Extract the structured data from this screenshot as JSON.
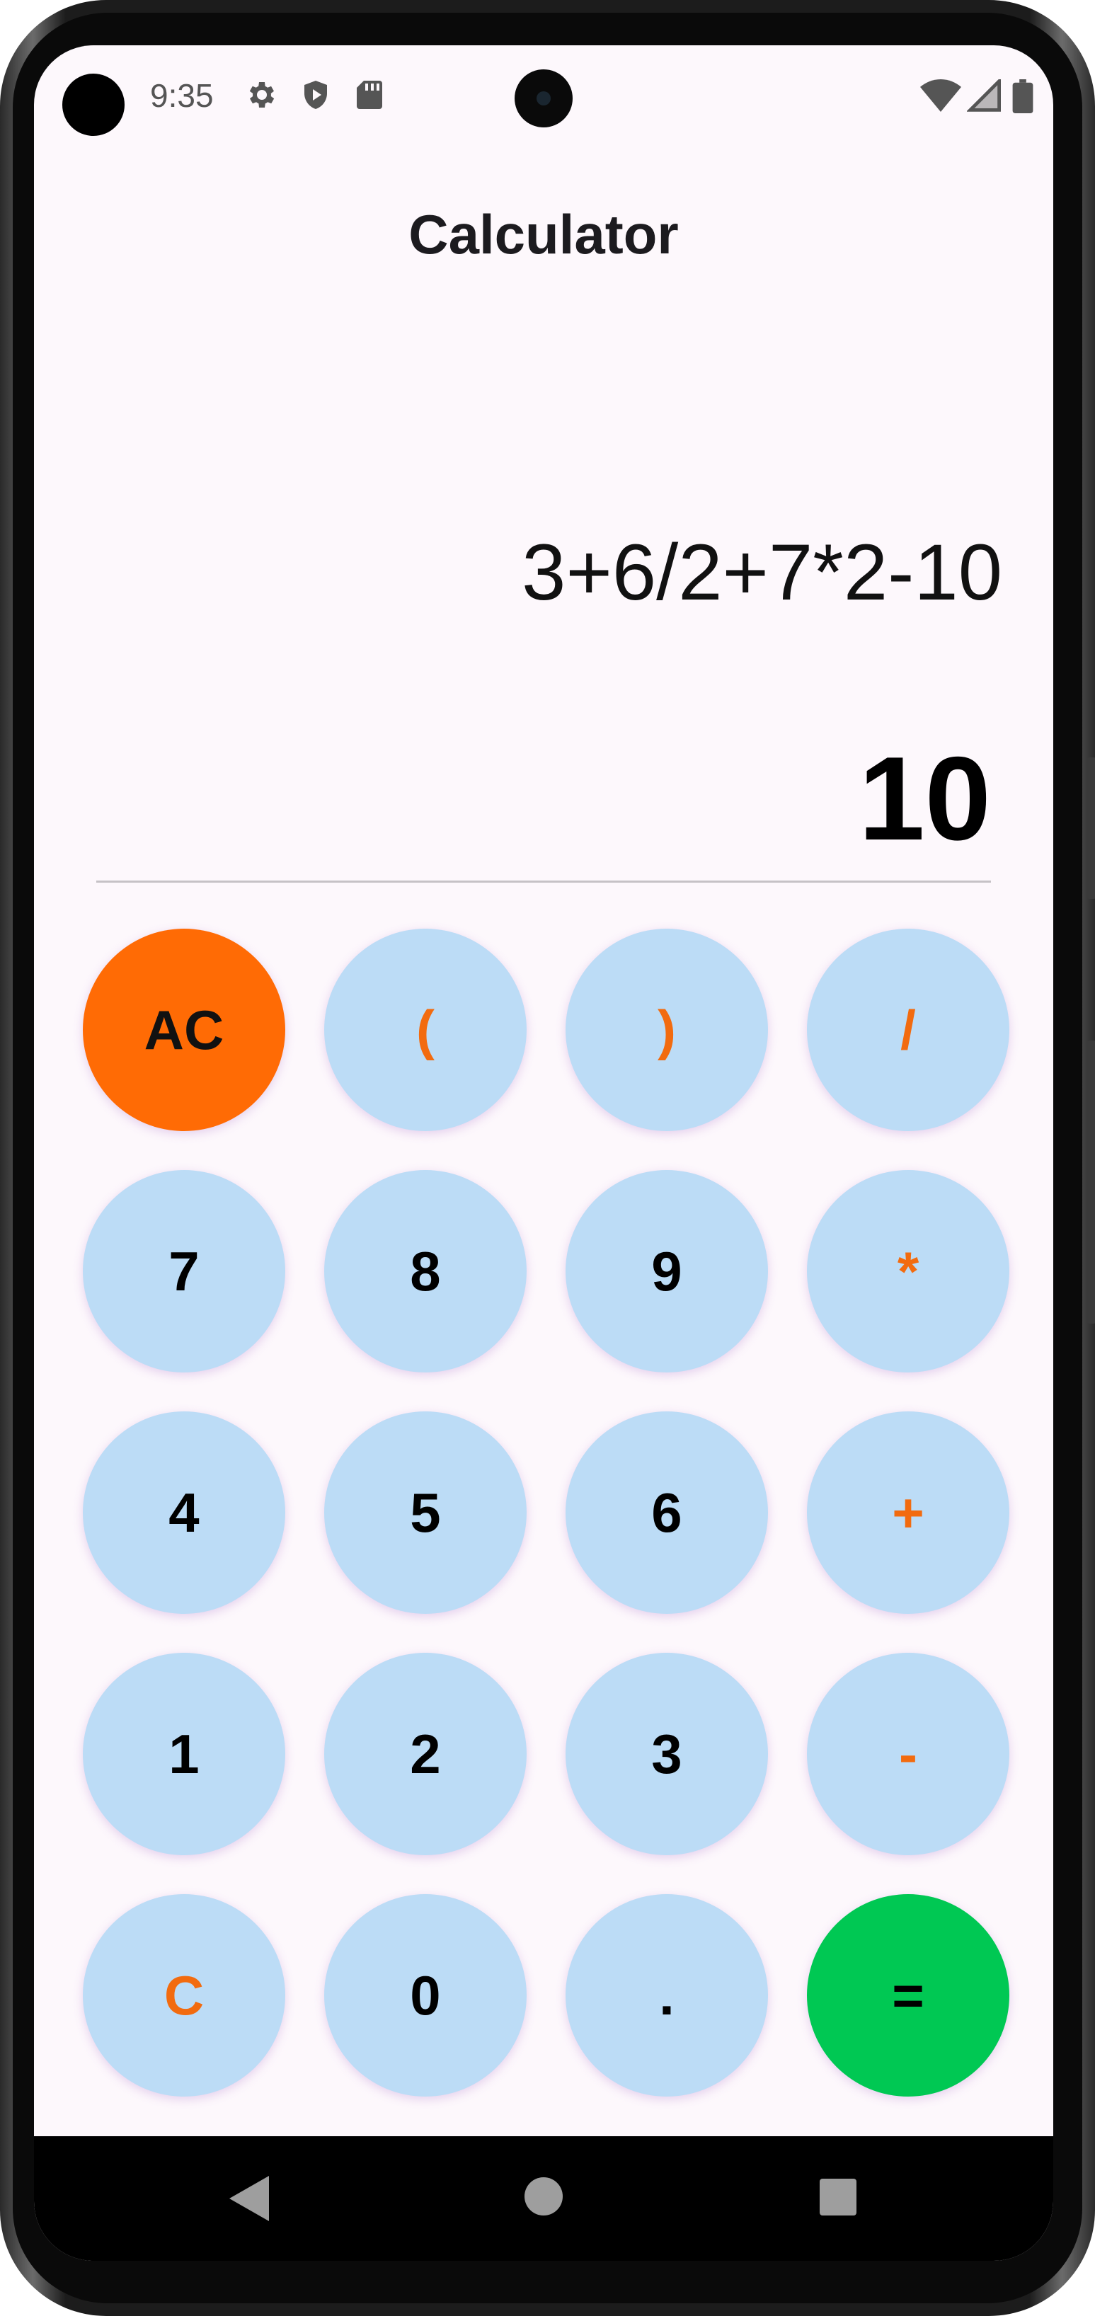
{
  "status_bar": {
    "time": "9:35",
    "left_icons": [
      "settings-icon",
      "play-protect-icon",
      "sd-card-icon"
    ],
    "right_icons": [
      "wifi-icon",
      "signal-icon",
      "battery-icon"
    ]
  },
  "app": {
    "title": "Calculator",
    "expression": "3+6/2+7*2-10",
    "result": "10"
  },
  "keypad": {
    "rows": [
      [
        {
          "label": "AC",
          "kind": "ac"
        },
        {
          "label": "(",
          "kind": "op"
        },
        {
          "label": ")",
          "kind": "op"
        },
        {
          "label": "/",
          "kind": "op"
        }
      ],
      [
        {
          "label": "7",
          "kind": "num"
        },
        {
          "label": "8",
          "kind": "num"
        },
        {
          "label": "9",
          "kind": "num"
        },
        {
          "label": "*",
          "kind": "op"
        }
      ],
      [
        {
          "label": "4",
          "kind": "num"
        },
        {
          "label": "5",
          "kind": "num"
        },
        {
          "label": "6",
          "kind": "num"
        },
        {
          "label": "+",
          "kind": "op"
        }
      ],
      [
        {
          "label": "1",
          "kind": "num"
        },
        {
          "label": "2",
          "kind": "num"
        },
        {
          "label": "3",
          "kind": "num"
        },
        {
          "label": "-",
          "kind": "op"
        }
      ],
      [
        {
          "label": "C",
          "kind": "op"
        },
        {
          "label": "0",
          "kind": "num"
        },
        {
          "label": ".",
          "kind": "num"
        },
        {
          "label": "=",
          "kind": "eq"
        }
      ]
    ]
  },
  "navigation": {
    "buttons": [
      "back-icon",
      "home-icon",
      "recents-icon"
    ]
  },
  "colors": {
    "key_background": "#bcdcf6",
    "operator_text": "#f26b0f",
    "ac_background": "#ff6b05",
    "equals_background": "#00c853",
    "screen_background": "#fdf8fc"
  }
}
